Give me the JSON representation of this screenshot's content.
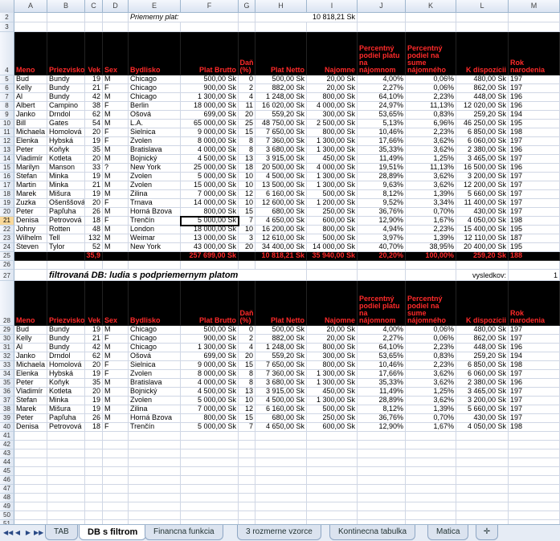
{
  "columns": [
    "A",
    "B",
    "C",
    "D",
    "E",
    "F",
    "G",
    "H",
    "I",
    "J",
    "K",
    "L",
    "M"
  ],
  "row2": {
    "label": "Priemerny plat:",
    "value": "10 818,21 Sk"
  },
  "headers": {
    "meno": "Meno",
    "priezvisko": "Priezvisko",
    "vek": "Vek",
    "sex": "Sex",
    "bydlisko": "Bydlisko",
    "brutto": "Plat Brutto",
    "dan": "Daň (%)",
    "netto": "Plat Netto",
    "najomne": "Najomne",
    "pct_plat": "Percentný podiel platu na nájomnom",
    "pct_suma": "Percentný podiel na sume nájomného",
    "dispozicia": "K dispozícii",
    "rok": "Rok narodenia"
  },
  "table1": [
    [
      "5",
      "Bud",
      "Bundy",
      "19",
      "M",
      "Chicago",
      "500,00 Sk",
      "0",
      "500,00 Sk",
      "20,00 Sk",
      "4,00%",
      "0,06%",
      "480,00 Sk",
      "197"
    ],
    [
      "6",
      "Kelly",
      "Bundy",
      "21",
      "F",
      "Chicago",
      "900,00 Sk",
      "2",
      "882,00 Sk",
      "20,00 Sk",
      "2,27%",
      "0,06%",
      "862,00 Sk",
      "197"
    ],
    [
      "7",
      "Al",
      "Bundy",
      "42",
      "M",
      "Chicago",
      "1 300,00 Sk",
      "4",
      "1 248,00 Sk",
      "800,00 Sk",
      "64,10%",
      "2,23%",
      "448,00 Sk",
      "196"
    ],
    [
      "8",
      "Albert",
      "Campino",
      "38",
      "F",
      "Berlin",
      "18 000,00 Sk",
      "11",
      "16 020,00 Sk",
      "4 000,00 Sk",
      "24,97%",
      "11,13%",
      "12 020,00 Sk",
      "196"
    ],
    [
      "9",
      "Janko",
      "Drndol",
      "62",
      "M",
      "Ošová",
      "699,00 Sk",
      "20",
      "559,20 Sk",
      "300,00 Sk",
      "53,65%",
      "0,83%",
      "259,20 Sk",
      "194"
    ],
    [
      "10",
      "Bill",
      "Gates",
      "54",
      "M",
      "L.A.",
      "65 000,00 Sk",
      "25",
      "48 750,00 Sk",
      "2 500,00 Sk",
      "5,13%",
      "6,96%",
      "46 250,00 Sk",
      "195"
    ],
    [
      "11",
      "Michaela",
      "Homolová",
      "20",
      "F",
      "Sielnica",
      "9 000,00 Sk",
      "15",
      "7 650,00 Sk",
      "800,00 Sk",
      "10,46%",
      "2,23%",
      "6 850,00 Sk",
      "198"
    ],
    [
      "12",
      "Elenka",
      "Hybská",
      "19",
      "F",
      "Zvolen",
      "8 000,00 Sk",
      "8",
      "7 360,00 Sk",
      "1 300,00 Sk",
      "17,66%",
      "3,62%",
      "6 060,00 Sk",
      "197"
    ],
    [
      "13",
      "Peter",
      "Koňyk",
      "35",
      "M",
      "Bratislava",
      "4 000,00 Sk",
      "8",
      "3 680,00 Sk",
      "1 300,00 Sk",
      "35,33%",
      "3,62%",
      "2 380,00 Sk",
      "196"
    ],
    [
      "14",
      "Vladimír",
      "Kotleta",
      "20",
      "M",
      "Bojnický",
      "4 500,00 Sk",
      "13",
      "3 915,00 Sk",
      "450,00 Sk",
      "11,49%",
      "1,25%",
      "3 465,00 Sk",
      "197"
    ],
    [
      "15",
      "Marilyn",
      "Manson",
      "33",
      "?",
      "New York",
      "25 000,00 Sk",
      "18",
      "20 500,00 Sk",
      "4 000,00 Sk",
      "19,51%",
      "11,13%",
      "16 500,00 Sk",
      "196"
    ],
    [
      "16",
      "Štefan",
      "Minka",
      "19",
      "M",
      "Zvolen",
      "5 000,00 Sk",
      "10",
      "4 500,00 Sk",
      "1 300,00 Sk",
      "28,89%",
      "3,62%",
      "3 200,00 Sk",
      "197"
    ],
    [
      "17",
      "Martin",
      "Minka",
      "21",
      "M",
      "Zvolen",
      "15 000,00 Sk",
      "10",
      "13 500,00 Sk",
      "1 300,00 Sk",
      "9,63%",
      "3,62%",
      "12 200,00 Sk",
      "197"
    ],
    [
      "18",
      "Marek",
      "Mišura",
      "19",
      "M",
      "Žilina",
      "7 000,00 Sk",
      "12",
      "6 160,00 Sk",
      "500,00 Sk",
      "8,12%",
      "1,39%",
      "5 660,00 Sk",
      "197"
    ],
    [
      "19",
      "Zuzka",
      "Ošenššová",
      "20",
      "F",
      "Trnava",
      "14 000,00 Sk",
      "10",
      "12 600,00 Sk",
      "1 200,00 Sk",
      "9,52%",
      "3,34%",
      "11 400,00 Sk",
      "197"
    ],
    [
      "20",
      "Peter",
      "Papľuha",
      "26",
      "M",
      "Horná Bzova",
      "800,00 Sk",
      "15",
      "680,00 Sk",
      "250,00 Sk",
      "36,76%",
      "0,70%",
      "430,00 Sk",
      "197"
    ],
    [
      "21",
      "Denisa",
      "Petrovová",
      "18",
      "F",
      "Trenčín",
      "5 000,00 Sk",
      "7",
      "4 650,00 Sk",
      "600,00 Sk",
      "12,90%",
      "1,67%",
      "4 050,00 Sk",
      "198"
    ],
    [
      "22",
      "Johny",
      "Rotten",
      "48",
      "M",
      "London",
      "18 000,00 Sk",
      "10",
      "16 200,00 Sk",
      "800,00 Sk",
      "4,94%",
      "2,23%",
      "15 400,00 Sk",
      "195"
    ],
    [
      "23",
      "Wilhelm",
      "Tell",
      "132",
      "M",
      "Weimar",
      "13 000,00 Sk",
      "3",
      "12 610,00 Sk",
      "500,00 Sk",
      "3,97%",
      "1,39%",
      "12 110,00 Sk",
      "187"
    ],
    [
      "24",
      "Steven",
      "Tylor",
      "52",
      "M",
      "New York",
      "43 000,00 Sk",
      "20",
      "34 400,00 Sk",
      "14 000,00 Sk",
      "40,70%",
      "38,95%",
      "20 400,00 Sk",
      "195"
    ]
  ],
  "totals": {
    "vek": "35,9",
    "brutto": "257 699,00 Sk",
    "netto": "10 818,21 Sk",
    "najomne": "35 940,00 Sk",
    "pct_plat": "20,20%",
    "pct_suma": "100,00%",
    "dispozicia": "259,20 Sk",
    "rok": "188"
  },
  "filter": {
    "title": "filtrovaná DB: ludia s podpriemernym platom",
    "result_label": "vysledkov:",
    "result_value": "1"
  },
  "table2": [
    [
      "29",
      "Bud",
      "Bundy",
      "19",
      "M",
      "Chicago",
      "500,00 Sk",
      "0",
      "500,00 Sk",
      "20,00 Sk",
      "4,00%",
      "0,06%",
      "480,00 Sk",
      "197"
    ],
    [
      "30",
      "Kelly",
      "Bundy",
      "21",
      "F",
      "Chicago",
      "900,00 Sk",
      "2",
      "882,00 Sk",
      "20,00 Sk",
      "2,27%",
      "0,06%",
      "862,00 Sk",
      "197"
    ],
    [
      "31",
      "Al",
      "Bundy",
      "42",
      "M",
      "Chicago",
      "1 300,00 Sk",
      "4",
      "1 248,00 Sk",
      "800,00 Sk",
      "64,10%",
      "2,23%",
      "448,00 Sk",
      "196"
    ],
    [
      "32",
      "Janko",
      "Drndol",
      "62",
      "M",
      "Ošová",
      "699,00 Sk",
      "20",
      "559,20 Sk",
      "300,00 Sk",
      "53,65%",
      "0,83%",
      "259,20 Sk",
      "194"
    ],
    [
      "33",
      "Michaela",
      "Homolová",
      "20",
      "F",
      "Sielnica",
      "9 000,00 Sk",
      "15",
      "7 650,00 Sk",
      "800,00 Sk",
      "10,46%",
      "2,23%",
      "6 850,00 Sk",
      "198"
    ],
    [
      "34",
      "Elenka",
      "Hybská",
      "19",
      "F",
      "Zvolen",
      "8 000,00 Sk",
      "8",
      "7 360,00 Sk",
      "1 300,00 Sk",
      "17,66%",
      "3,62%",
      "6 060,00 Sk",
      "197"
    ],
    [
      "35",
      "Peter",
      "Koňyk",
      "35",
      "M",
      "Bratislava",
      "4 000,00 Sk",
      "8",
      "3 680,00 Sk",
      "1 300,00 Sk",
      "35,33%",
      "3,62%",
      "2 380,00 Sk",
      "196"
    ],
    [
      "36",
      "Vladimír",
      "Kotleta",
      "20",
      "M",
      "Bojnický",
      "4 500,00 Sk",
      "13",
      "3 915,00 Sk",
      "450,00 Sk",
      "11,49%",
      "1,25%",
      "3 465,00 Sk",
      "197"
    ],
    [
      "37",
      "Štefan",
      "Minka",
      "19",
      "M",
      "Zvolen",
      "5 000,00 Sk",
      "10",
      "4 500,00 Sk",
      "1 300,00 Sk",
      "28,89%",
      "3,62%",
      "3 200,00 Sk",
      "197"
    ],
    [
      "38",
      "Marek",
      "Mišura",
      "19",
      "M",
      "Žilina",
      "7 000,00 Sk",
      "12",
      "6 160,00 Sk",
      "500,00 Sk",
      "8,12%",
      "1,39%",
      "5 660,00 Sk",
      "197"
    ],
    [
      "39",
      "Peter",
      "Papľuha",
      "26",
      "M",
      "Horná Bzova",
      "800,00 Sk",
      "15",
      "680,00 Sk",
      "250,00 Sk",
      "36,76%",
      "0,70%",
      "430,00 Sk",
      "197"
    ],
    [
      "40",
      "Denisa",
      "Petrovová",
      "18",
      "F",
      "Trenčín",
      "5 000,00 Sk",
      "7",
      "4 650,00 Sk",
      "600,00 Sk",
      "12,90%",
      "1,67%",
      "4 050,00 Sk",
      "198"
    ]
  ],
  "empty_rows": [
    "41",
    "42",
    "43",
    "44",
    "45",
    "46",
    "47",
    "48",
    "49",
    "50",
    "51",
    "52"
  ],
  "row_labels": {
    "r2": "2",
    "r3": "3",
    "r4": "4",
    "r25": "25",
    "r26": "26",
    "r27": "27",
    "r28": "28"
  },
  "tabs": [
    "TAB",
    "DB s filtrom",
    "Financna funkcia",
    "3 rozmerne vzorce",
    "Kontinecna tabulka",
    "Matica"
  ],
  "active_tab": "DB s filtrom",
  "nav_icons": [
    "first-sheet-icon",
    "prev-sheet-icon",
    "next-sheet-icon",
    "last-sheet-icon"
  ],
  "colors": {
    "header_bg": "#000000",
    "header_text": "#ff2a2a",
    "selection": "#000000"
  }
}
